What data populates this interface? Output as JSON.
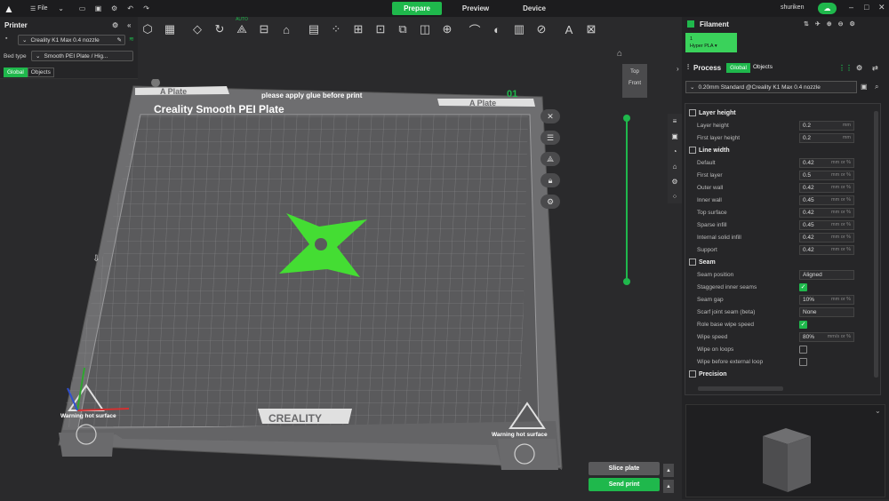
{
  "topbar": {
    "file_label": "File",
    "tabs": [
      "Prepare",
      "Preview",
      "Device"
    ],
    "user": "shuriken"
  },
  "printer": {
    "title": "Printer",
    "printer_name": "Creality K1 Max 0.4 nozzle",
    "bed_type_label": "Bed type",
    "bed_type_value": "Smooth PEI Plate / Hig...",
    "global_label": "Global",
    "objects_label": "Objects"
  },
  "viewport": {
    "plate_title": "Creality Smooth PEI Plate",
    "plate_name_left": "A Plate",
    "plate_name_right": "A Plate",
    "glue_note": "please apply glue before print",
    "plate_number": "01",
    "brand": "CREALITY",
    "warning_left": "Warning hot surface",
    "warning_right": "Warning hot surface",
    "nav_top": "Top",
    "nav_front": "Front",
    "slider_fill_fraction": 1.0
  },
  "actions": {
    "slice_label": "Slice plate",
    "send_label": "Send print"
  },
  "filament": {
    "title": "Filament",
    "slot_number": "1",
    "slot_name": "Hyper PLA ▾"
  },
  "process": {
    "title": "Process",
    "global_label": "Global",
    "objects_label": "Objects",
    "preset": "0.20mm Standard @Creality K1 Max 0.4 nozzle"
  },
  "params": [
    {
      "type": "section",
      "label": "Layer height"
    },
    {
      "type": "num",
      "label": "Layer height",
      "value": "0.2",
      "unit": "mm"
    },
    {
      "type": "num",
      "label": "First layer height",
      "value": "0.2",
      "unit": "mm"
    },
    {
      "type": "section",
      "label": "Line width"
    },
    {
      "type": "num",
      "label": "Default",
      "value": "0.42",
      "unit": "mm or %"
    },
    {
      "type": "num",
      "label": "First layer",
      "value": "0.5",
      "unit": "mm or %"
    },
    {
      "type": "num",
      "label": "Outer wall",
      "value": "0.42",
      "unit": "mm or %"
    },
    {
      "type": "num",
      "label": "Inner wall",
      "value": "0.45",
      "unit": "mm or %"
    },
    {
      "type": "num",
      "label": "Top surface",
      "value": "0.42",
      "unit": "mm or %"
    },
    {
      "type": "num",
      "label": "Sparse infill",
      "value": "0.45",
      "unit": "mm or %"
    },
    {
      "type": "num",
      "label": "Internal solid infill",
      "value": "0.42",
      "unit": "mm or %"
    },
    {
      "type": "num",
      "label": "Support",
      "value": "0.42",
      "unit": "mm or %"
    },
    {
      "type": "section",
      "label": "Seam"
    },
    {
      "type": "num",
      "label": "Seam position",
      "value": "Aligned",
      "unit": ""
    },
    {
      "type": "check",
      "label": "Staggered inner seams",
      "checked": true
    },
    {
      "type": "num",
      "label": "Seam gap",
      "value": "10%",
      "unit": "mm or %"
    },
    {
      "type": "num",
      "label": "Scarf joint seam (beta)",
      "value": "None",
      "unit": ""
    },
    {
      "type": "check",
      "label": "Role base wipe speed",
      "checked": true
    },
    {
      "type": "num",
      "label": "Wipe speed",
      "value": "80%",
      "unit": "mm/s or %"
    },
    {
      "type": "check",
      "label": "Wipe on loops",
      "checked": false
    },
    {
      "type": "check",
      "label": "Wipe before external loop",
      "checked": false
    },
    {
      "type": "section",
      "label": "Precision"
    }
  ],
  "colors": {
    "accent": "#1fb84c",
    "part": "#44dd33"
  }
}
